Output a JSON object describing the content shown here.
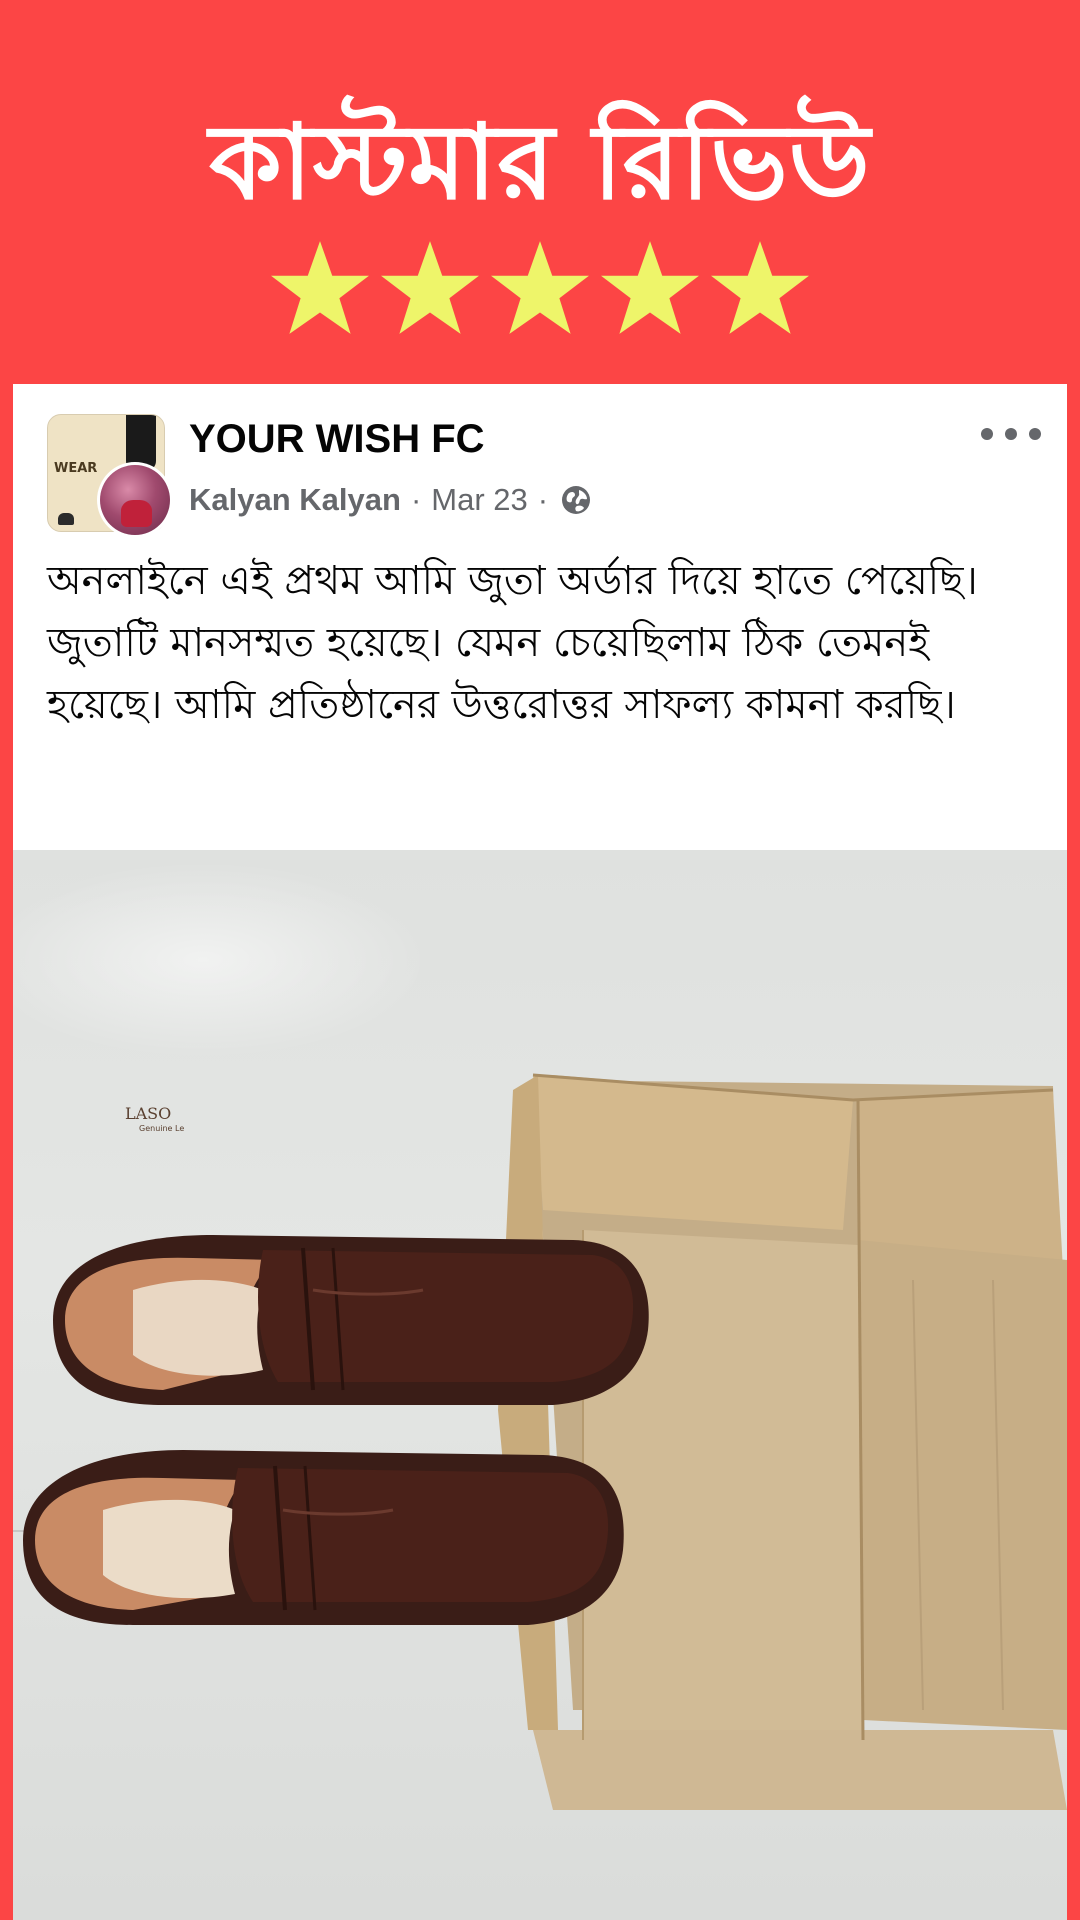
{
  "banner": {
    "title": "কাস্টমার রিভিউ",
    "rating": 5,
    "star_color": "#eef56a"
  },
  "post": {
    "page_name": "YOUR WISH FC",
    "author": "Kalyan Kalyan",
    "date": "Mar 23",
    "separator": "·",
    "visibility_icon": "globe-icon",
    "more_icon": "more-options-icon",
    "avatar_text": "WEAR",
    "body": "অনলাইনে এই প্রথম আমি জুতা অর্ডার দিয়ে হাতে পেয়েছি। জুতাটি মানসম্মত হয়েছে। যেমন চেয়েছিলাম ঠিক তেমনই হয়েছে। আমি প্রতিষ্ঠানের উত্তরোত্তর সাফল্য কামনা করছি।",
    "photo": {
      "insole_brand": "LASO",
      "insole_sub": "Genuine Le"
    }
  },
  "colors": {
    "background": "#fc4545",
    "card": "#ffffff",
    "text_primary": "#050505",
    "text_secondary": "#65676b"
  }
}
